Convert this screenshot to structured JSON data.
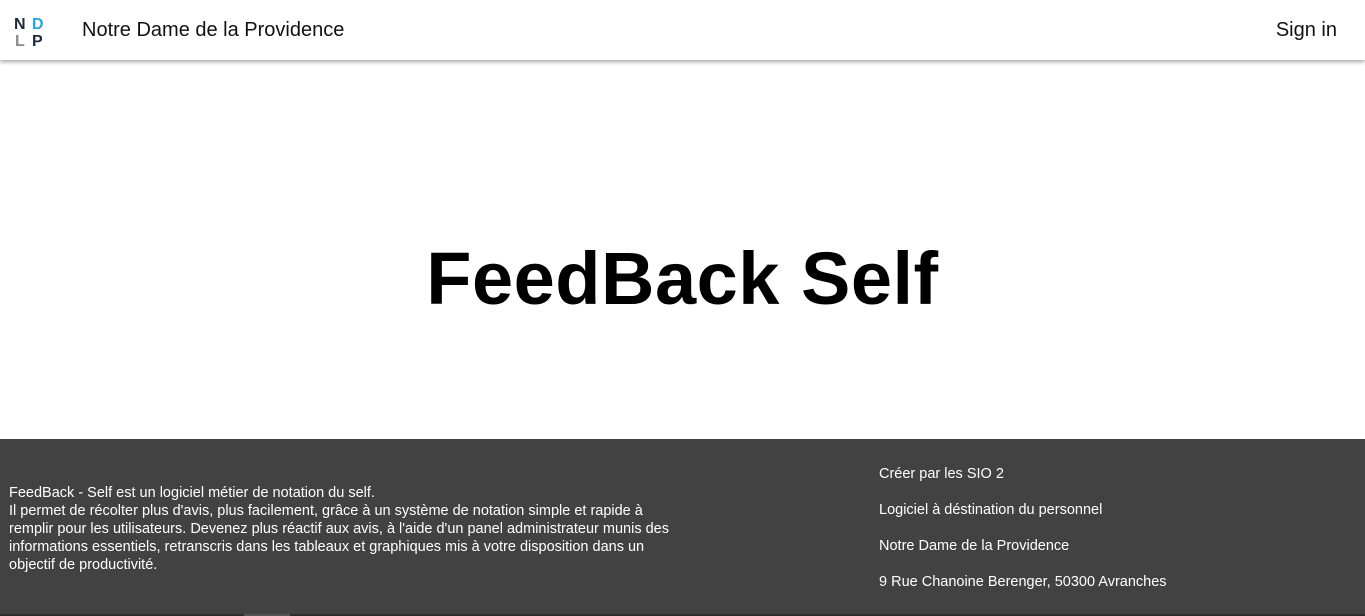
{
  "header": {
    "logo_letters": [
      "N",
      "D",
      "L",
      "P"
    ],
    "brand": "Notre Dame de la Providence",
    "signin_label": "Sign in"
  },
  "hero": {
    "title": "FeedBack Self"
  },
  "footer": {
    "description": [
      "FeedBack - Self est un logiciel métier de notation du self.",
      "Il permet de récolter plus d'avis, plus facilement, grâce à un système de notation simple et rapide à remplir pour les utilisateurs. Devenez plus réactif aux avis, à l'aide d'un panel administrateur munis des informations essentiels, retranscris dans les tableaux et graphiques mis à votre disposition dans un objectif de productivité."
    ],
    "info": [
      "Créer par les SIO 2",
      "Logiciel à déstination du personnel",
      "Notre Dame de la Providence",
      "9 Rue Chanoine Berenger, 50300 Avranches"
    ]
  },
  "colors": {
    "footer_bg": "#424242",
    "logo_dark": "#1f2a36",
    "logo_blue": "#2aa4d8",
    "logo_gray": "#8a8a8a"
  }
}
